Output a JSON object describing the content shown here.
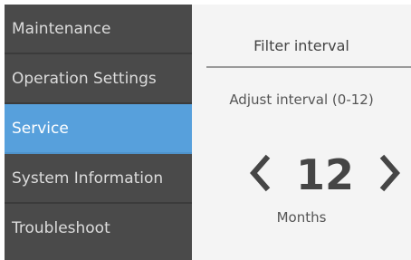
{
  "sidebar": {
    "items": [
      {
        "label": "Maintenance",
        "active": false
      },
      {
        "label": "Operation Settings",
        "active": false
      },
      {
        "label": "Service",
        "active": true
      },
      {
        "label": "System Information",
        "active": false
      },
      {
        "label": "Troubleshoot",
        "active": false
      }
    ]
  },
  "panel": {
    "title": "Filter interval",
    "subtitle": "Adjust interval (0-12)",
    "value": "12",
    "unit": "Months",
    "range": {
      "min": 0,
      "max": 12
    }
  },
  "icons": {
    "decrease": "chevron-left-icon",
    "increase": "chevron-right-icon"
  },
  "colors": {
    "sidebar_bg": "#4a4a4a",
    "active_bg": "#57a0dc",
    "panel_bg": "#f4f4f4"
  }
}
